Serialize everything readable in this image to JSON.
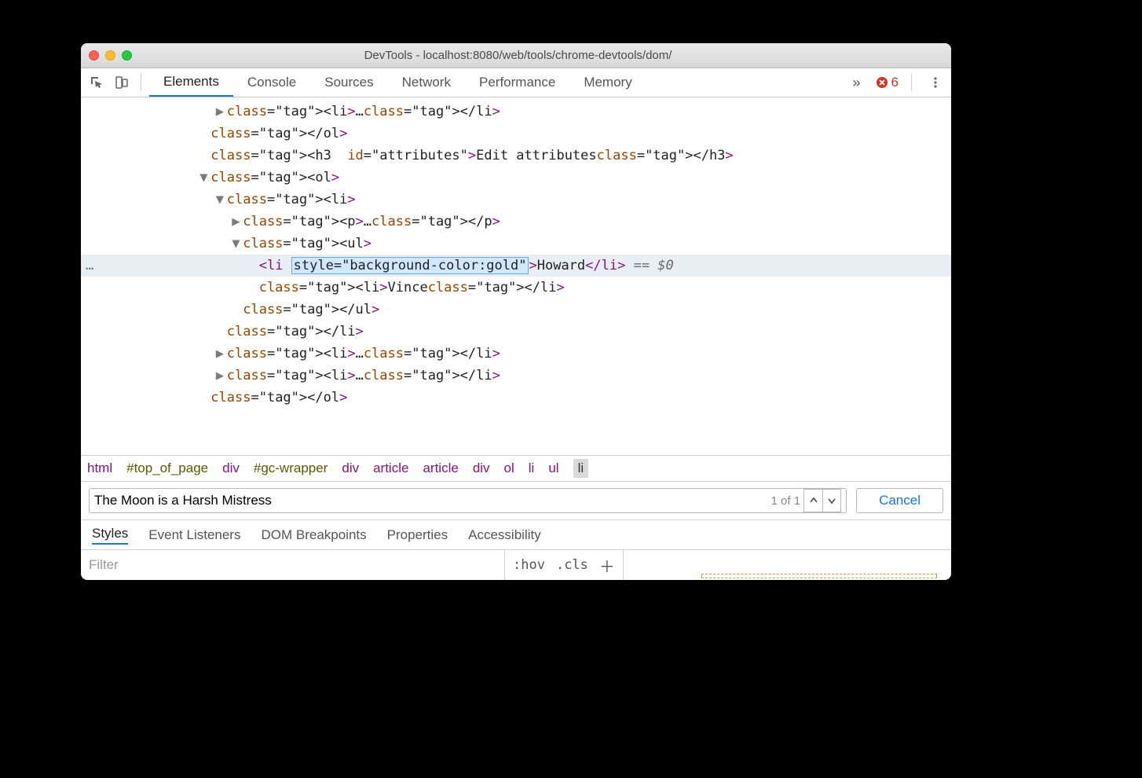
{
  "titlebar": {
    "title": "DevTools - localhost:8080/web/tools/chrome-devtools/dom/"
  },
  "toolbar": {
    "tabs": [
      "Elements",
      "Console",
      "Sources",
      "Network",
      "Performance",
      "Memory"
    ],
    "active_tab": 0,
    "overflow_glyph": "»",
    "error_count": "6"
  },
  "dom": {
    "rows": [
      {
        "indent": 8,
        "arrow": "▶",
        "html": "<li>…</li>"
      },
      {
        "indent": 7,
        "html": "</ol>"
      },
      {
        "indent": 7,
        "html": "<h3 id=\"attributes\">Edit attributes</h3>"
      },
      {
        "indent": 7,
        "arrow": "▼",
        "html": "<ol>"
      },
      {
        "indent": 8,
        "arrow": "▼",
        "html": "<li>"
      },
      {
        "indent": 9,
        "arrow": "▶",
        "html": "<p>…</p>"
      },
      {
        "indent": 9,
        "arrow": "▼",
        "html": "<ul>"
      },
      {
        "indent": 10,
        "highlight": true,
        "edit_attr": "style=\"background-color:gold\"",
        "text": "Howard",
        "tail": " == $0"
      },
      {
        "indent": 10,
        "html": "<li>Vince</li>"
      },
      {
        "indent": 9,
        "html": "</ul>"
      },
      {
        "indent": 8,
        "html": "</li>"
      },
      {
        "indent": 8,
        "arrow": "▶",
        "html": "<li>…</li>"
      },
      {
        "indent": 8,
        "arrow": "▶",
        "html": "<li>…</li>"
      },
      {
        "indent": 7,
        "html": "</ol>"
      }
    ]
  },
  "breadcrumb": [
    "html",
    "#top_of_page",
    "div",
    "#gc-wrapper",
    "div",
    "article",
    "article",
    "div",
    "ol",
    "li",
    "ul",
    "li"
  ],
  "breadcrumb_selected": 11,
  "search": {
    "value": "The Moon is a Harsh Mistress",
    "count": "1 of 1",
    "cancel": "Cancel"
  },
  "subtabs": [
    "Styles",
    "Event Listeners",
    "DOM Breakpoints",
    "Properties",
    "Accessibility"
  ],
  "subtabs_active": 0,
  "styles": {
    "filter_placeholder": "Filter",
    "hov": ":hov",
    "cls": ".cls"
  }
}
